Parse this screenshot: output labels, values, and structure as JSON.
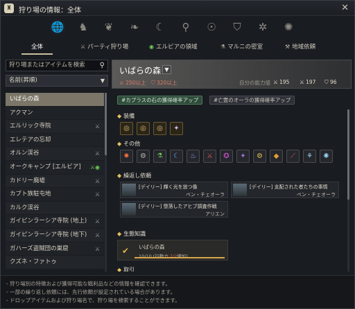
{
  "window": {
    "title": "狩り場の情報：全体",
    "close_label": "✕"
  },
  "categories": [
    {
      "name": "globe-icon",
      "glyph": "🌐"
    },
    {
      "name": "horse-icon",
      "glyph": "♞"
    },
    {
      "name": "wolf-icon",
      "glyph": "❦"
    },
    {
      "name": "wing-icon",
      "glyph": "❧"
    },
    {
      "name": "moon-icon",
      "glyph": "☾"
    },
    {
      "name": "crest-icon",
      "glyph": "⚲"
    },
    {
      "name": "mask-icon",
      "glyph": "☉"
    },
    {
      "name": "shield-icon",
      "glyph": "⛉"
    },
    {
      "name": "spark-icon",
      "glyph": "✲"
    },
    {
      "name": "sun-icon",
      "glyph": "✺"
    }
  ],
  "tabs": {
    "all": "全体",
    "party": "パーティ狩り場",
    "elvia": "エルビアの領域",
    "marni": "マルニの密室",
    "regional": "地域依頼"
  },
  "search": {
    "placeholder": "狩り場またはアイテムを検索"
  },
  "sort": {
    "label": "名前(昇順)"
  },
  "list": [
    {
      "label": "いばらの森",
      "icon": ""
    },
    {
      "label": "アクマン",
      "icon": ""
    },
    {
      "label": "エルリック寺院",
      "icon": "⚔"
    },
    {
      "label": "エレテアの忘却",
      "icon": ""
    },
    {
      "label": "オルン渓谷",
      "icon": "⚔"
    },
    {
      "label": "オークキャンプ [エルビア]",
      "icon": "⚔◉"
    },
    {
      "label": "カドリー廃墟",
      "icon": "⚔"
    },
    {
      "label": "カブト族駐屯地",
      "icon": "⚔"
    },
    {
      "label": "カルク渓谷",
      "icon": ""
    },
    {
      "label": "ガイピンラーシア寺院 (地上)",
      "icon": "⚔"
    },
    {
      "label": "ガイピンラーシア寺院 (地下)",
      "icon": "⚔"
    },
    {
      "label": "ガハーズ盗賊団の巣窟",
      "icon": "⚔"
    },
    {
      "label": "クズネ・ファトゥ",
      "icon": ""
    }
  ],
  "detail": {
    "name": "いばらの森",
    "ap": "250以上",
    "dp": "320以上",
    "my_label": "自分の能力値",
    "stat1": "195",
    "stat2": "197",
    "stat3": "96",
    "chip1": "#カプラスの石の獲得確率アップ",
    "chip2": "#亡霊のオーラの獲得確率アップ",
    "sec_equipment": "装備",
    "sec_other": "その他",
    "sec_quests": "繰返し依頼",
    "sec_knowledge": "生態知識",
    "sec_next": "取引",
    "quests": [
      {
        "title": "[デイリー] 輝く光を放つ像",
        "giver": "ベン・チェオーラ"
      },
      {
        "title": "[デイリー] 支配された者たちの事情",
        "giver": "ベン・チェオーラ"
      },
      {
        "title": "[デイリー] 堕落したアヒブ調査作戦",
        "giver": "アリエン"
      }
    ],
    "knowledge": {
      "name": "いばらの森",
      "progress": "10/10 (行動力",
      "progress_red": "2/2",
      "progress_end": "増加)",
      "fill": 1.0
    }
  },
  "footer": [
    "- 狩り場別の特徴および獲得可能な戦利品などの情報を確認できます。",
    "- 一部の繰り返し依頼には、先行依頼が設定されている場合があります。",
    "- ドロップアイテムおよび狩り場名で、狩り場を検索することができます。"
  ]
}
